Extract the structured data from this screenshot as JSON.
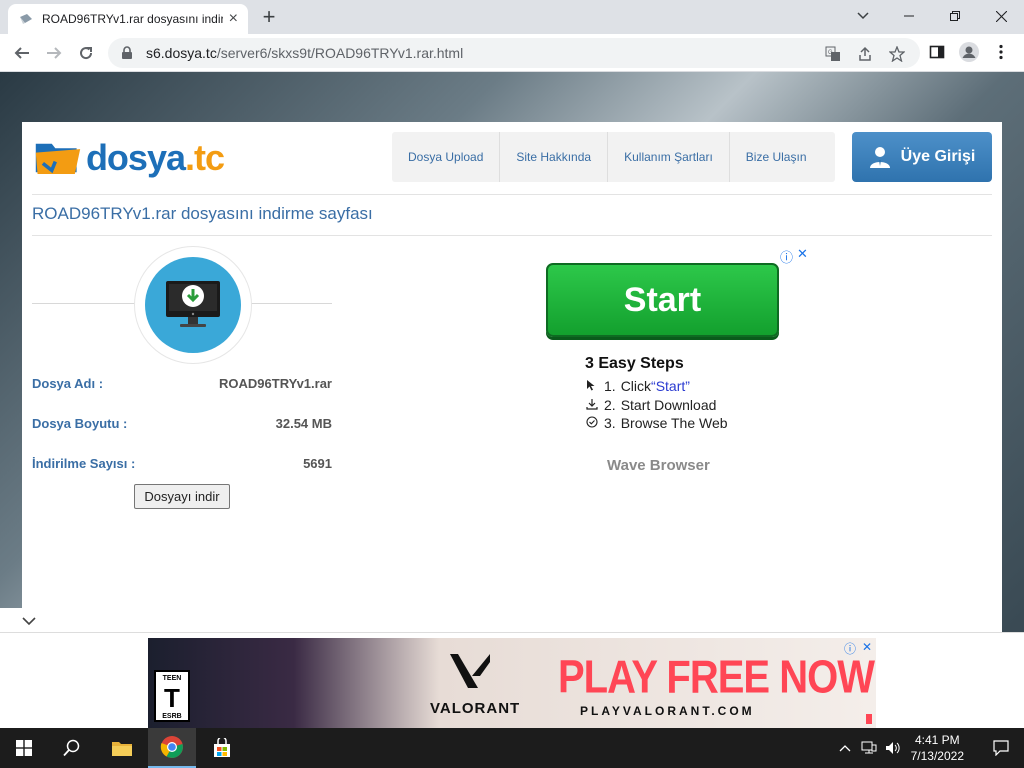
{
  "browser": {
    "tab_title": "ROAD96TRYv1.rar dosyasını indir",
    "tab_close": "×",
    "new_tab": "+",
    "url_host": "s6.dosya.tc",
    "url_path": "/server6/skxs9t/ROAD96TRYv1.rar.html"
  },
  "site": {
    "logo_part1": "dosya",
    "logo_part2": ".tc",
    "nav": [
      "Dosya Upload",
      "Site Hakkında",
      "Kullanım Şartları",
      "Bize Ulaşın"
    ],
    "login": "Üye Girişi",
    "page_heading": "ROAD96TRYv1.rar dosyasını indirme sayfası"
  },
  "file": {
    "name_label": "Dosya Adı :",
    "name_value": "ROAD96TRYv1.rar",
    "size_label": "Dosya Boyutu :",
    "size_value": "32.54 MB",
    "downloads_label": "İndirilme Sayısı :",
    "downloads_value": "5691",
    "download_button": "Dosyayı indir"
  },
  "ad": {
    "button": "Start",
    "steps_title": "3 Easy Steps",
    "step1_num": "1.",
    "step1_pre": "Click ",
    "step1_link": "“Start”",
    "step2_num": "2.",
    "step2_text": "Start Download",
    "step3_num": "3.",
    "step3_text": "Browse The Web",
    "brand": "Wave Browser",
    "info": "ⓘ",
    "close": "✕"
  },
  "banner": {
    "rating_top": "TEEN",
    "rating_letter": "T",
    "rating_bottom": "ESRB",
    "game": "VALORANT",
    "cta": "PLAY FREE NOW",
    "cta_url": "PLAYVALORANT.COM",
    "info": "ⓘ",
    "close": "✕",
    "collapse": "⌄"
  },
  "taskbar": {
    "time": "4:41 PM",
    "date": "7/13/2022"
  },
  "colors": {
    "brand_blue": "#3a6ea5",
    "start_green": "#1fb53c",
    "cta_red": "#ff4655"
  }
}
